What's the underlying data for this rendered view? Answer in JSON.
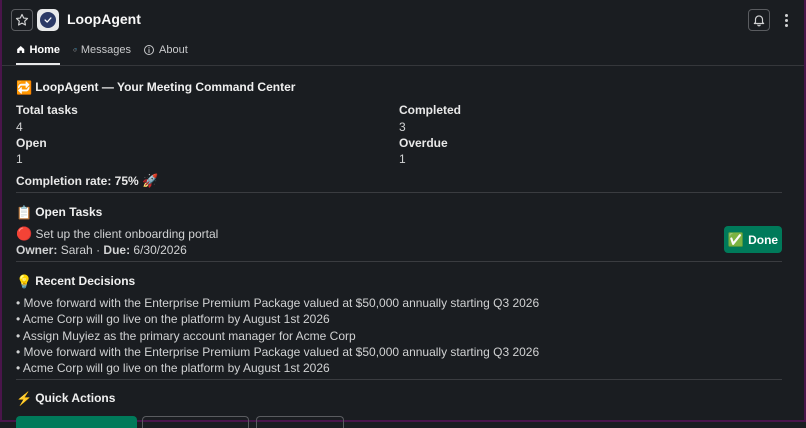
{
  "app": {
    "title": "LoopAgent"
  },
  "tabs": [
    {
      "label": "Home",
      "active": true
    },
    {
      "label": "Messages",
      "active": false
    },
    {
      "label": "About",
      "active": false
    }
  ],
  "header": {
    "title": "LoopAgent — Your Meeting Command Center",
    "icon": "🔁"
  },
  "stats": {
    "total_label": "Total tasks",
    "total_value": "4",
    "completed_label": "Completed",
    "completed_value": "3",
    "open_label": "Open",
    "open_value": "1",
    "overdue_label": "Overdue",
    "overdue_value": "1",
    "completion_text": "Completion rate: 75%",
    "completion_emoji": "🚀"
  },
  "open_tasks": {
    "title": "Open Tasks",
    "icon": "📋",
    "items": [
      {
        "status_icon": "🔴",
        "text": "Set up the client onboarding portal",
        "owner_label": "Owner:",
        "owner": "Sarah",
        "due_label": "Due:",
        "due": "6/30/2026",
        "button_label": "Done",
        "button_icon": "✅"
      }
    ]
  },
  "decisions": {
    "title": "Recent Decisions",
    "icon": "💡",
    "items": [
      "• Move forward with the Enterprise Premium Package valued at $50,000 annually starting Q3 2026",
      "• Acme Corp will go live on the platform by August 1st 2026",
      "• Assign Muyiez as the primary account manager for Acme Corp",
      "• Move forward with the Enterprise Premium Package valued at $50,000 annually starting Q3 2026",
      "• Acme Corp will go live on the platform by August 1st 2026"
    ]
  },
  "quick_actions": {
    "title": "Quick Actions",
    "icon": "⚡"
  },
  "colors": {
    "background": "#1a1d21",
    "accent_green": "#007a5a",
    "border_purple": "#4a154b"
  }
}
